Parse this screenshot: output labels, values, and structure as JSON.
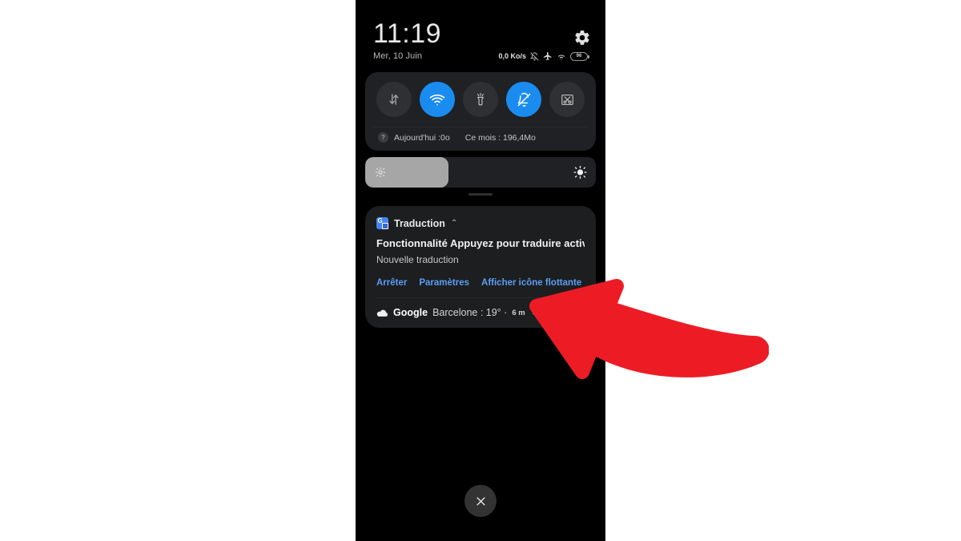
{
  "status_bar": {
    "clock": "11:19",
    "date": "Mer, 10 Juin",
    "net_speed": "0,0 Ko/s",
    "battery_percent": "96",
    "icons": [
      "alarm-off-icon",
      "airplane-mode-icon",
      "wifi-icon",
      "battery-icon"
    ],
    "settings_icon": "gear-icon"
  },
  "quick_settings": {
    "toggles": [
      {
        "name": "mobile-data",
        "icon": "data-transfer-icon",
        "active": false
      },
      {
        "name": "wifi",
        "icon": "wifi-icon",
        "active": true
      },
      {
        "name": "flashlight",
        "icon": "flashlight-icon",
        "active": false
      },
      {
        "name": "silent-mode",
        "icon": "bell-off-icon",
        "active": true
      },
      {
        "name": "screenshot",
        "icon": "scissors-frame-icon",
        "active": false
      }
    ],
    "data_help_glyph": "?",
    "data_today": "Aujourd'hui :0o",
    "data_month": "Ce mois : 196,4Mo"
  },
  "brightness": {
    "level_percent": "36",
    "low_icon": "brightness-low-icon",
    "high_icon": "brightness-high-icon"
  },
  "notification": {
    "app_icon": "google-translate-icon",
    "app_icon_letter": "G",
    "app_name": "Traduction",
    "collapse_glyph": "⌃",
    "title": "Fonctionnalité Appuyez pour traduire activé..",
    "subtitle": "Nouvelle traduction",
    "actions": [
      {
        "name": "stop",
        "label": "Arrêter"
      },
      {
        "name": "settings",
        "label": "Paramètres"
      },
      {
        "name": "show-floating-icon",
        "label": "Afficher icône flottante"
      }
    ]
  },
  "weather": {
    "cloud_icon": "cloud-icon",
    "source": "Google",
    "text": "Barcelone : 19° ·",
    "altitude": "6 m",
    "expand_glyph": "⌄"
  },
  "close_button": {
    "name": "close-shade-button",
    "icon": "close-icon"
  },
  "annotation": {
    "arrow_color": "#ED1C24",
    "name": "red-curved-arrow"
  }
}
